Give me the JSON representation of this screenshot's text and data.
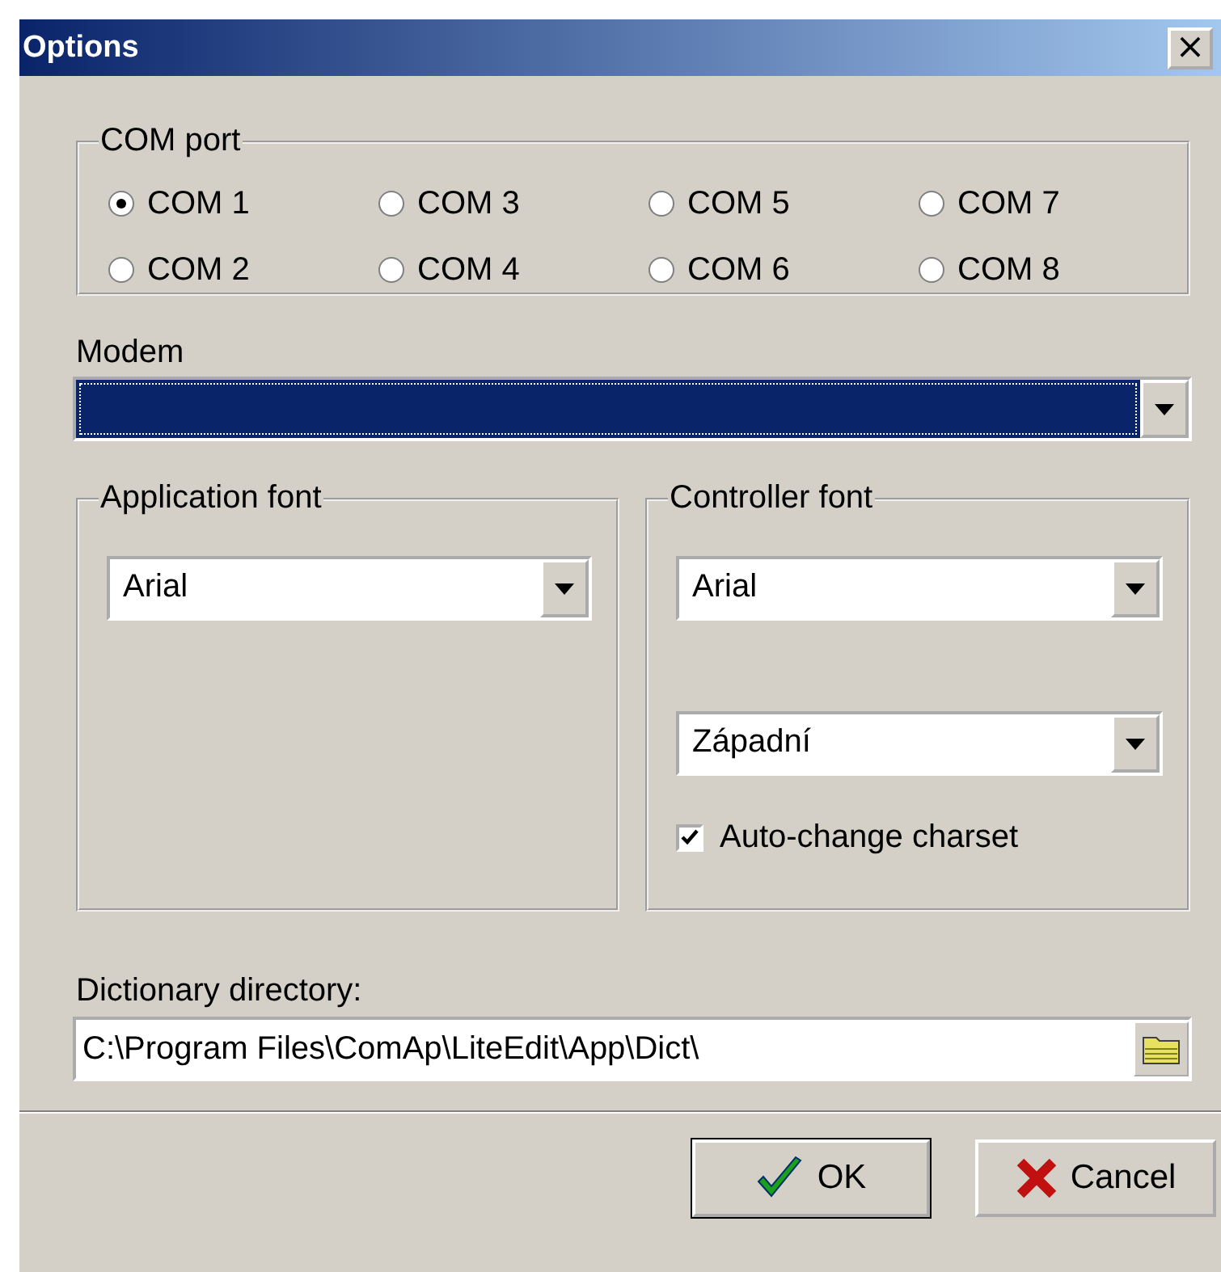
{
  "window": {
    "title": "Options",
    "close": "×"
  },
  "com_port": {
    "label": "COM port",
    "options": [
      {
        "label": "COM 1",
        "selected": true
      },
      {
        "label": "COM 3",
        "selected": false
      },
      {
        "label": "COM 5",
        "selected": false
      },
      {
        "label": "COM 7",
        "selected": false
      },
      {
        "label": "COM 2",
        "selected": false
      },
      {
        "label": "COM 4",
        "selected": false
      },
      {
        "label": "COM 6",
        "selected": false
      },
      {
        "label": "COM 8",
        "selected": false
      }
    ]
  },
  "modem": {
    "label": "Modem",
    "focused": true
  },
  "application_font": {
    "label": "Application font",
    "value": "Arial"
  },
  "controller_font": {
    "label": "Controller font",
    "font": "Arial",
    "charset": "Západní",
    "auto_change": {
      "label": "Auto-change charset",
      "checked": true
    }
  },
  "dictionary": {
    "label": "Dictionary directory:",
    "value": "C:\\Program Files\\ComAp\\LiteEdit\\App\\Dict\\"
  },
  "buttons": [
    {
      "kind": "ok",
      "label": "OK"
    },
    {
      "kind": "cancel",
      "label": "Cancel"
    }
  ]
}
